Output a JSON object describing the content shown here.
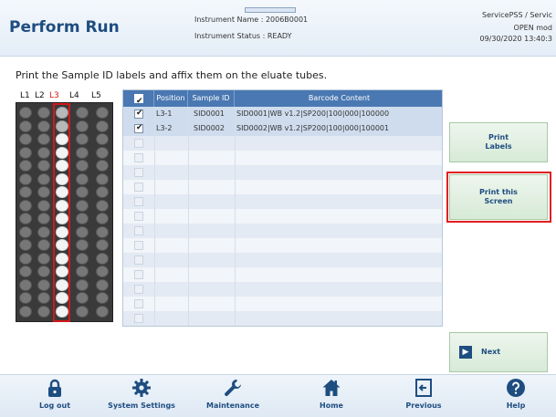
{
  "header": {
    "title": "Perform Run",
    "instrument_name": "Instrument Name : 2006B0001",
    "instrument_status": "Instrument Status : READY",
    "user": "ServicePSS / Servic",
    "mode": "OPEN mod",
    "datetime": "09/30/2020 13:40:3"
  },
  "instruction": "Print the Sample ID labels and affix them on the eluate tubes.",
  "lanes": [
    "L1",
    "L2",
    "L3",
    "L4",
    "L5"
  ],
  "active_lane": "L3",
  "table": {
    "headers": [
      "Position",
      "Sample ID",
      "Barcode Content"
    ],
    "header_checked": true,
    "rows": [
      {
        "checked": true,
        "position": "L3-1",
        "sample_id": "SID0001",
        "barcode": "SID0001|WB v1.2|SP200|100|000|100000"
      },
      {
        "checked": true,
        "position": "L3-2",
        "sample_id": "SID0002",
        "barcode": "SID0002|WB v1.2|SP200|100|000|100001"
      }
    ],
    "empty_rows": 13
  },
  "buttons": {
    "print_labels": "Print\nLabels",
    "print_screen": "Print this\nScreen",
    "next": "Next"
  },
  "nav": {
    "logout": "Log out",
    "system_settings": "System Settings",
    "maintenance": "Maintenance",
    "home": "Home",
    "previous": "Previous",
    "help": "Help"
  },
  "colors": {
    "accent": "#1e4d80",
    "header_table": "#4a78b2",
    "highlight": "#d01919"
  }
}
